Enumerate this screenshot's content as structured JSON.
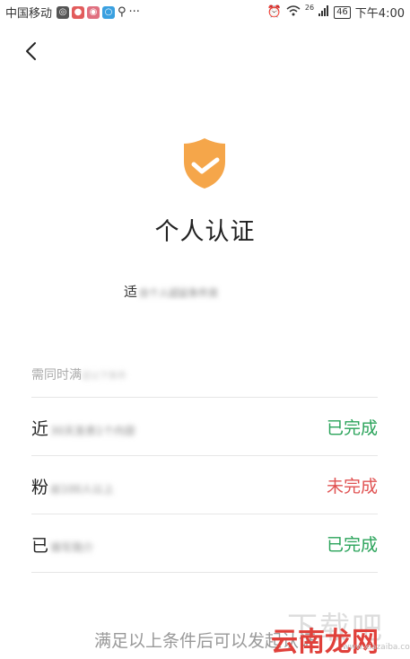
{
  "status_bar": {
    "carrier": "中国移动",
    "more": "···",
    "network": "26",
    "battery": "46",
    "time": "下午4:00"
  },
  "page": {
    "title": "个人认证",
    "description_prefix": "适",
    "description_blurred": "合个人認証条件资",
    "requirements_heading_prefix": "需同时满",
    "requirements_heading_blurred": "足以下条件"
  },
  "requirements": [
    {
      "label_prefix": "近",
      "label_blurred": "30天发表1个内容",
      "status": "已完成",
      "state": "done"
    },
    {
      "label_prefix": "粉",
      "label_blurred": "丝100人以上",
      "status": "未完成",
      "state": "todo"
    },
    {
      "label_prefix": "已",
      "label_blurred": "填写简介",
      "status": "已完成",
      "state": "done"
    }
  ],
  "footer": {
    "note": "满足以上条件后可以发起认证"
  },
  "watermark": {
    "top": "下载吧",
    "main": "云南龙网",
    "sub": "www.xiazaiba.com"
  },
  "colors": {
    "shield": "#f5a64a",
    "done": "#2aa35a",
    "todo": "#e05252"
  }
}
